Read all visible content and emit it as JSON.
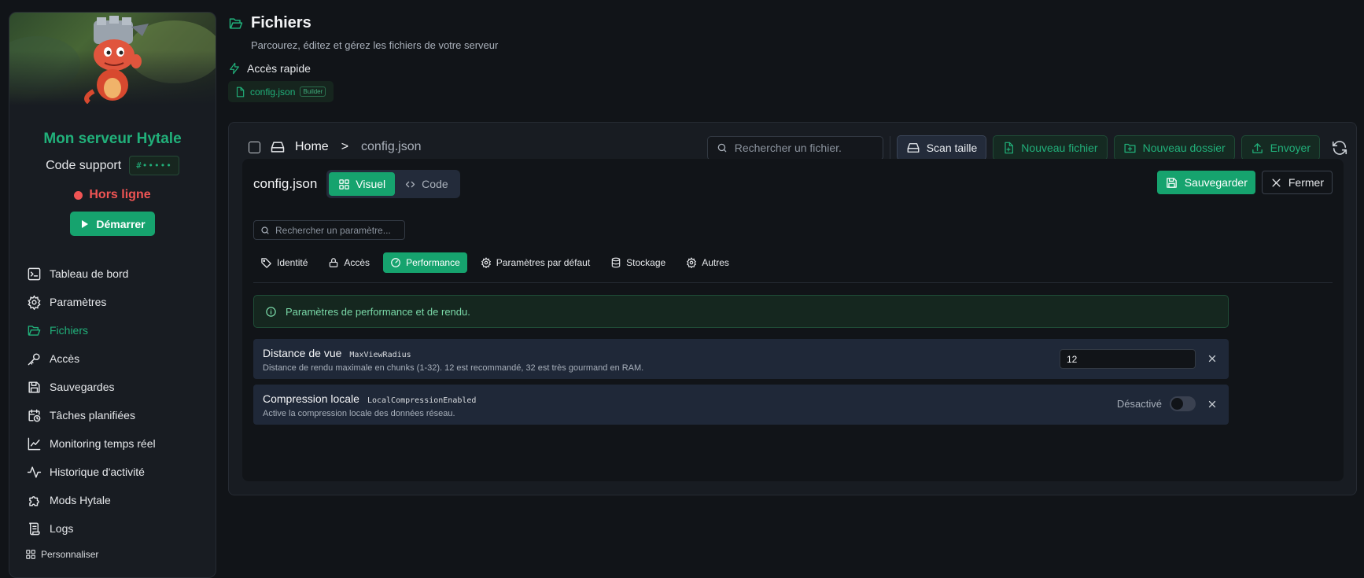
{
  "sidebar": {
    "server_name": "Mon serveur Hytale",
    "support_label": "Code support",
    "support_code": "#•••••",
    "status": "Hors ligne",
    "start_label": "Démarrer",
    "items": [
      {
        "label": "Tableau de bord",
        "icon": "terminal-icon"
      },
      {
        "label": "Paramètres",
        "icon": "gear-icon"
      },
      {
        "label": "Fichiers",
        "icon": "folder-open-icon",
        "active": true
      },
      {
        "label": "Accès",
        "icon": "key-icon"
      },
      {
        "label": "Sauvegardes",
        "icon": "save-icon"
      },
      {
        "label": "Tâches planifiées",
        "icon": "calendar-clock-icon"
      },
      {
        "label": "Monitoring temps réel",
        "icon": "line-chart-icon"
      },
      {
        "label": "Historique d'activité",
        "icon": "activity-icon"
      },
      {
        "label": "Mods Hytale",
        "icon": "puzzle-icon"
      },
      {
        "label": "Logs",
        "icon": "scroll-icon"
      }
    ],
    "personalize_label": "Personnaliser"
  },
  "header": {
    "title": "Fichiers",
    "subtitle": "Parcourez, éditez et gérez les fichiers de votre serveur",
    "quick_access_label": "Accès rapide",
    "quick_file": "config.json",
    "quick_badge": "Builder"
  },
  "toolbar": {
    "breadcrumb_home": "Home",
    "breadcrumb_sep": ">",
    "breadcrumb_file": "config.json",
    "search_placeholder": "Rechercher un fichier.",
    "scan_label": "Scan taille",
    "new_file_label": "Nouveau fichier",
    "new_folder_label": "Nouveau dossier",
    "upload_label": "Envoyer"
  },
  "editor": {
    "file_name": "config.json",
    "tab_visual": "Visuel",
    "tab_code": "Code",
    "save_label": "Sauvegarder",
    "close_label": "Fermer",
    "param_search_placeholder": "Rechercher un paramètre...",
    "categories": [
      {
        "label": "Identité",
        "icon": "tag-icon"
      },
      {
        "label": "Accès",
        "icon": "lock-icon"
      },
      {
        "label": "Performance",
        "icon": "gauge-icon",
        "active": true
      },
      {
        "label": "Paramètres par défaut",
        "icon": "gear-icon"
      },
      {
        "label": "Stockage",
        "icon": "database-icon"
      },
      {
        "label": "Autres",
        "icon": "gear-icon"
      }
    ],
    "info": "Paramètres de performance et de rendu.",
    "settings": [
      {
        "name": "Distance de vue",
        "key": "MaxViewRadius",
        "desc": "Distance de rendu maximale en chunks (1-32). 12 est recommandé, 32 est très gourmand en RAM.",
        "value": "12"
      },
      {
        "name": "Compression locale",
        "key": "LocalCompressionEnabled",
        "desc": "Active la compression locale des données réseau.",
        "toggle_label": "Désactivé",
        "enabled": false
      }
    ]
  },
  "colors": {
    "accent": "#16a36e",
    "accent_text": "#21b07a",
    "offline": "#f05454",
    "background": "#111418",
    "panel": "#181c22"
  }
}
